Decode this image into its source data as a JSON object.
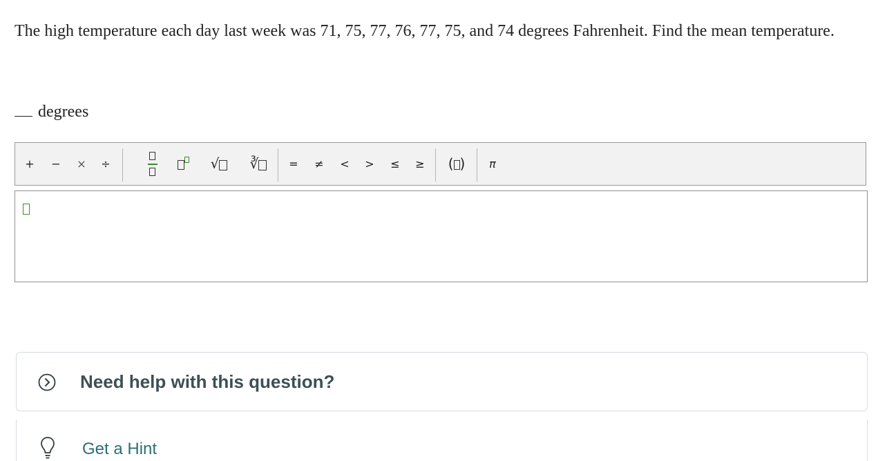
{
  "question": {
    "text": "The high temperature each day last week was 71, 75, 77, 76, 77, 75, and 74 degrees Fahrenheit. Find the mean temperature."
  },
  "answer": {
    "unit": "degrees"
  },
  "toolbar": {
    "plus": "+",
    "minus": "−",
    "times": "×",
    "divide": "÷",
    "sqrt_symbol": "√",
    "cbrt_symbol": "∛",
    "equals": "=",
    "not_equal": "≠",
    "less_than": "<",
    "greater_than": ">",
    "less_equal": "≤",
    "greater_equal": "≥",
    "paren_open": "(",
    "paren_close": ")",
    "pi": "π"
  },
  "help": {
    "title": "Need help with this question?",
    "hint_label": "Get a Hint"
  },
  "colors": {
    "accent_green": "#3a8a2a",
    "help_text": "#3d4f55",
    "hint_text": "#2a6f77"
  }
}
